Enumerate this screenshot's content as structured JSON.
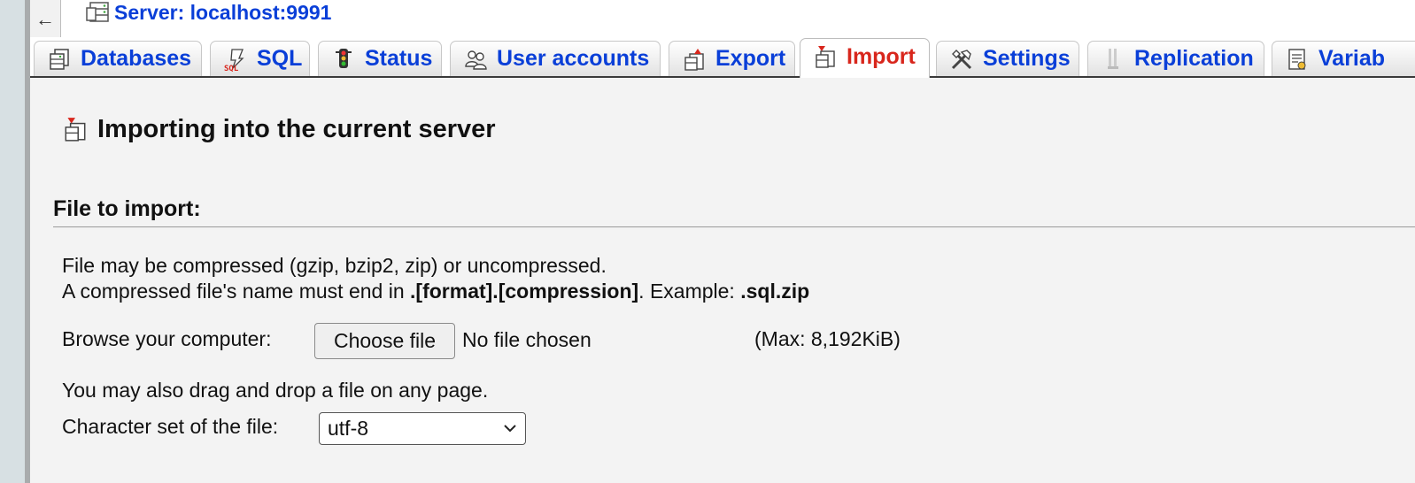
{
  "header": {
    "back_arrow": "←",
    "server_label": "Server: localhost:9991"
  },
  "tabs": [
    {
      "label": "Databases",
      "icon": "database-icon",
      "active": false
    },
    {
      "label": "SQL",
      "icon": "sql-icon",
      "active": false
    },
    {
      "label": "Status",
      "icon": "traffic-light-icon",
      "active": false
    },
    {
      "label": "User accounts",
      "icon": "users-icon",
      "active": false
    },
    {
      "label": "Export",
      "icon": "export-icon",
      "active": false
    },
    {
      "label": "Import",
      "icon": "import-icon",
      "active": true
    },
    {
      "label": "Settings",
      "icon": "tools-icon",
      "active": false
    },
    {
      "label": "Replication",
      "icon": "replication-icon",
      "active": false
    },
    {
      "label": "Variab",
      "icon": "variables-icon",
      "active": false
    }
  ],
  "page": {
    "title": "Importing into the current server",
    "section_title": "File to import:",
    "compression_note": "File may be compressed (gzip, bzip2, zip) or uncompressed.",
    "name_note_prefix": "A compressed file's name must end in ",
    "name_note_format": ".[format].[compression]",
    "name_note_middle": ". Example: ",
    "name_note_example": ".sql.zip",
    "browse_label": "Browse your computer:",
    "choose_button": "Choose file",
    "no_file_text": "No file chosen",
    "max_size": "(Max: 8,192KiB)",
    "drag_note": "You may also drag and drop a file on any page.",
    "charset_label": "Character set of the file:",
    "charset_value": "utf-8"
  },
  "colors": {
    "link": "#0a3fd8",
    "active_tab": "#d8261c",
    "background": "#f3f3f3"
  }
}
